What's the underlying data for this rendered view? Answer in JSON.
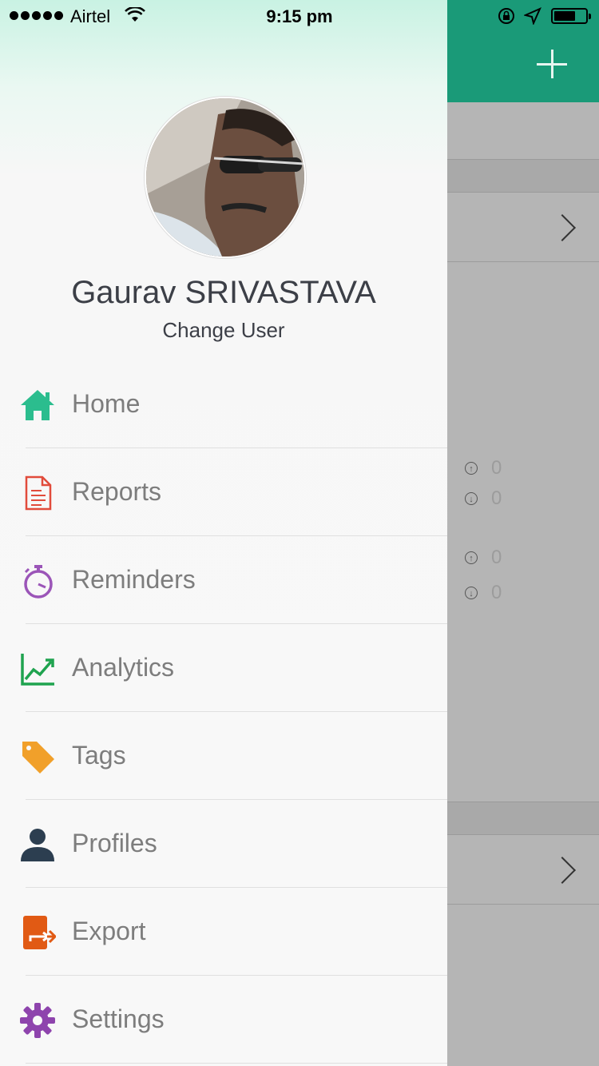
{
  "status_bar": {
    "carrier": "Airtel",
    "time": "9:15 pm"
  },
  "drawer": {
    "user_name": "Gaurav SRIVASTAVA",
    "change_user": "Change User",
    "menu": [
      {
        "label": "Home",
        "icon": "home-icon",
        "color": "#2bbd8e"
      },
      {
        "label": "Reports",
        "icon": "report-document-icon",
        "color": "#e14b3b"
      },
      {
        "label": "Reminders",
        "icon": "stopwatch-icon",
        "color": "#9b55b8"
      },
      {
        "label": "Analytics",
        "icon": "line-chart-icon",
        "color": "#1fa34f"
      },
      {
        "label": "Tags",
        "icon": "tag-icon",
        "color": "#f1a02a"
      },
      {
        "label": "Profiles",
        "icon": "person-icon",
        "color": "#2c3e50"
      },
      {
        "label": "Export",
        "icon": "export-icon",
        "color": "#e15a14"
      },
      {
        "label": "Settings",
        "icon": "gear-icon",
        "color": "#8e44ad"
      }
    ]
  },
  "background": {
    "header_color": "#1a9a78",
    "stats": [
      {
        "direction": "up",
        "value": "0"
      },
      {
        "direction": "down",
        "value": "0"
      },
      {
        "direction": "up",
        "value": "0"
      },
      {
        "direction": "down",
        "value": "0"
      }
    ]
  }
}
